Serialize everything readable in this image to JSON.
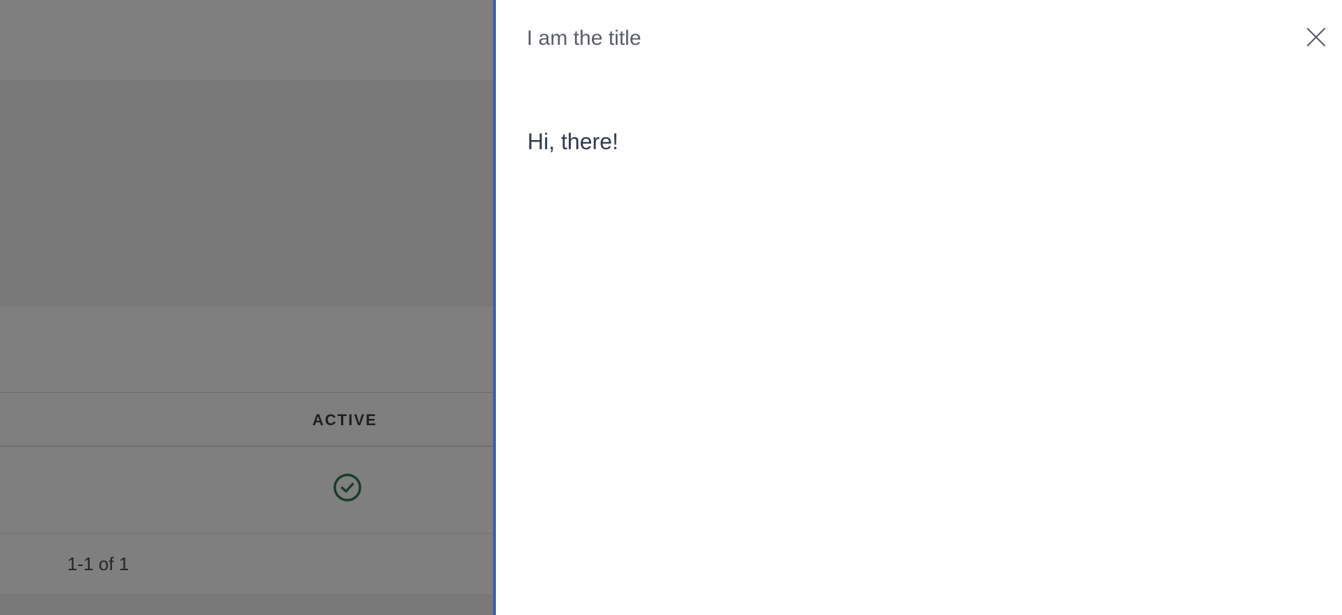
{
  "table": {
    "column_active_label": "ACTIVE",
    "rows": [
      {
        "active": true,
        "status_icon": "check-circle-icon"
      }
    ],
    "pagination_text": "1-1 of 1"
  },
  "drawer": {
    "title": "I am the title",
    "body_text": "Hi, there!",
    "close_icon": "close-icon"
  },
  "colors": {
    "drawer_accent": "#3a5fb0",
    "success": "#2e7d4f"
  }
}
